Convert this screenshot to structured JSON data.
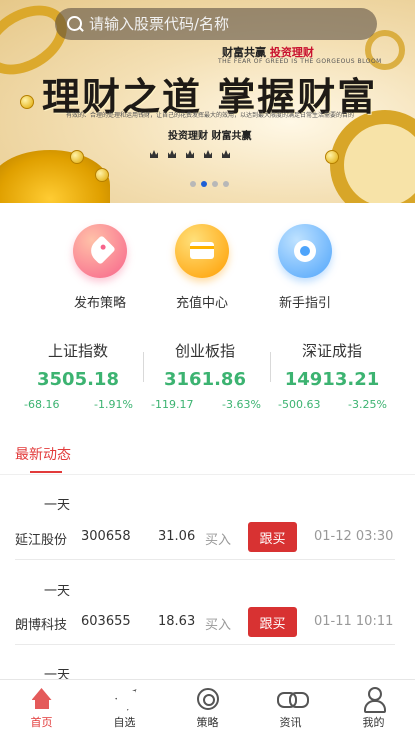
{
  "banner": {
    "title": "理财之道 掌握财富",
    "tagline_black": "财富共赢",
    "tagline_red": "投资理财",
    "english": "THE FEAR OF GREED IS THE GORGEOUS BLOOM",
    "description": "有效的、合理的处理和运用钱财，让自己的花费发挥最大的效用，以达到最大限度的满足日常生活需要的目的",
    "subtitle": "投资理财 财富共赢",
    "page_count": 4,
    "active_page": 2
  },
  "search": {
    "placeholder": "请输入股票代码/名称"
  },
  "quick_menu": [
    {
      "label": "发布策略",
      "icon": "tag-icon"
    },
    {
      "label": "充值中心",
      "icon": "card-icon"
    },
    {
      "label": "新手指引",
      "icon": "flower-icon"
    }
  ],
  "indices": [
    {
      "name": "上证指数",
      "value": "3505.18",
      "change": "-68.16",
      "percent": "-1.91%"
    },
    {
      "name": "创业板指",
      "value": "3161.86",
      "change": "-119.17",
      "percent": "-3.63%"
    },
    {
      "name": "深证成指",
      "value": "14913.21",
      "change": "-500.63",
      "percent": "-3.25%"
    }
  ],
  "latest": {
    "title": "最新动态",
    "items": [
      {
        "user": "一天",
        "name": "延江股份",
        "code": "300658",
        "price": "31.06",
        "action": "买入",
        "button": "跟买",
        "time": "01-12 03:30"
      },
      {
        "user": "一天",
        "name": "朗博科技",
        "code": "603655",
        "price": "18.63",
        "action": "买入",
        "button": "跟买",
        "time": "01-11 10:11"
      },
      {
        "user": "一天"
      }
    ]
  },
  "tabbar": [
    {
      "label": "首页",
      "icon": "home-icon",
      "active": true
    },
    {
      "label": "自选",
      "icon": "send-icon"
    },
    {
      "label": "策略",
      "icon": "target-icon"
    },
    {
      "label": "资讯",
      "icon": "link-icon"
    },
    {
      "label": "我的",
      "icon": "user-icon"
    }
  ],
  "colors": {
    "accent_red": "#e23b3b",
    "index_green": "#3cb371",
    "follow_button": "#d83232",
    "pager_active": "#1e5fd6"
  }
}
